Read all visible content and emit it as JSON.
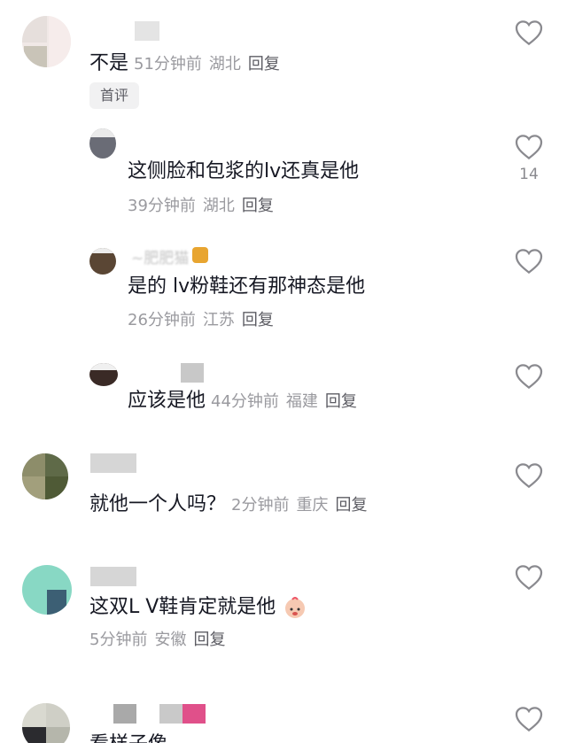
{
  "comments": [
    {
      "text": "不是",
      "time": "51分钟前",
      "location": "湖北",
      "reply": "回复",
      "badge": "首评"
    },
    {
      "text": "这侧脸和包浆的lv还真是他",
      "time": "39分钟前",
      "location": "湖北",
      "reply": "回复",
      "likes": "14"
    },
    {
      "name": "~肥肥猫",
      "text": "是的 lv粉鞋还有那神态是他",
      "time": "26分钟前",
      "location": "江苏",
      "reply": "回复"
    },
    {
      "text": "应该是他",
      "time": "44分钟前",
      "location": "福建",
      "reply": "回复"
    },
    {
      "text": "就他一个人吗？",
      "time": "2分钟前",
      "location": "重庆",
      "reply": "回复"
    },
    {
      "text": "这双L V鞋肯定就是他",
      "time": "5分钟前",
      "location": "安徽",
      "reply": "回复"
    },
    {
      "text": "看样子像"
    }
  ],
  "colors": {
    "text": "#161823",
    "meta": "#9a9a9f",
    "reply": "#5c5c63",
    "heart": "#8a8a8f"
  }
}
